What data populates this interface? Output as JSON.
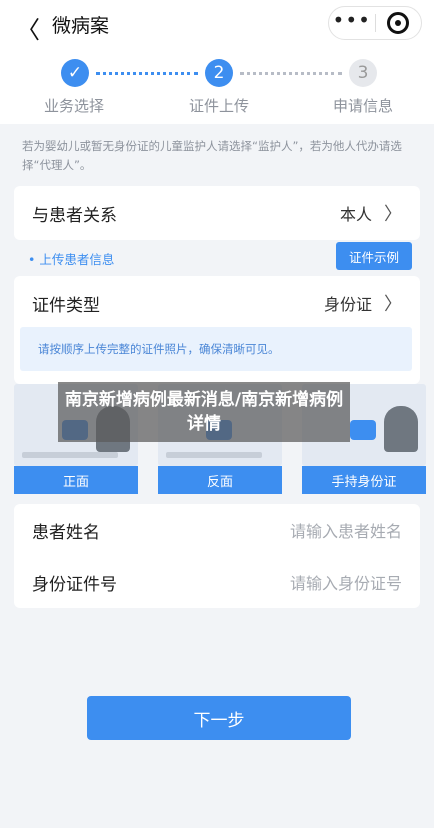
{
  "header": {
    "back_glyph": "〈",
    "title": "微病案",
    "more_glyph": "•••"
  },
  "steps": [
    {
      "number": "✓",
      "label": "业务选择",
      "state": "done"
    },
    {
      "number": "2",
      "label": "证件上传",
      "state": "active"
    },
    {
      "number": "3",
      "label": "申请信息",
      "state": "pending"
    }
  ],
  "hint": "若为婴幼儿或暂无身份证的儿童监护人请选择“监护人”，若为他人代办请选择“代理人”。",
  "relation": {
    "label": "与患者关系",
    "value": "本人"
  },
  "upload": {
    "title": "• 上传患者信息",
    "sample_button": "证件示例",
    "id_type_label": "证件类型",
    "id_type_value": "身份证",
    "notice": "请按顺序上传完整的证件照片，确保清晰可见。",
    "photo_buttons": [
      "正面",
      "反面",
      "手持身份证"
    ]
  },
  "overlay": "南京新增病例最新消息/南京新增病例详情",
  "form": {
    "name_label": "患者姓名",
    "name_placeholder": "请输入患者姓名",
    "id_label": "身份证件号",
    "id_placeholder": "请输入身份证号"
  },
  "next_button": "下一步",
  "colors": {
    "accent": "#3d8ef0",
    "background": "#f2f4f7"
  }
}
